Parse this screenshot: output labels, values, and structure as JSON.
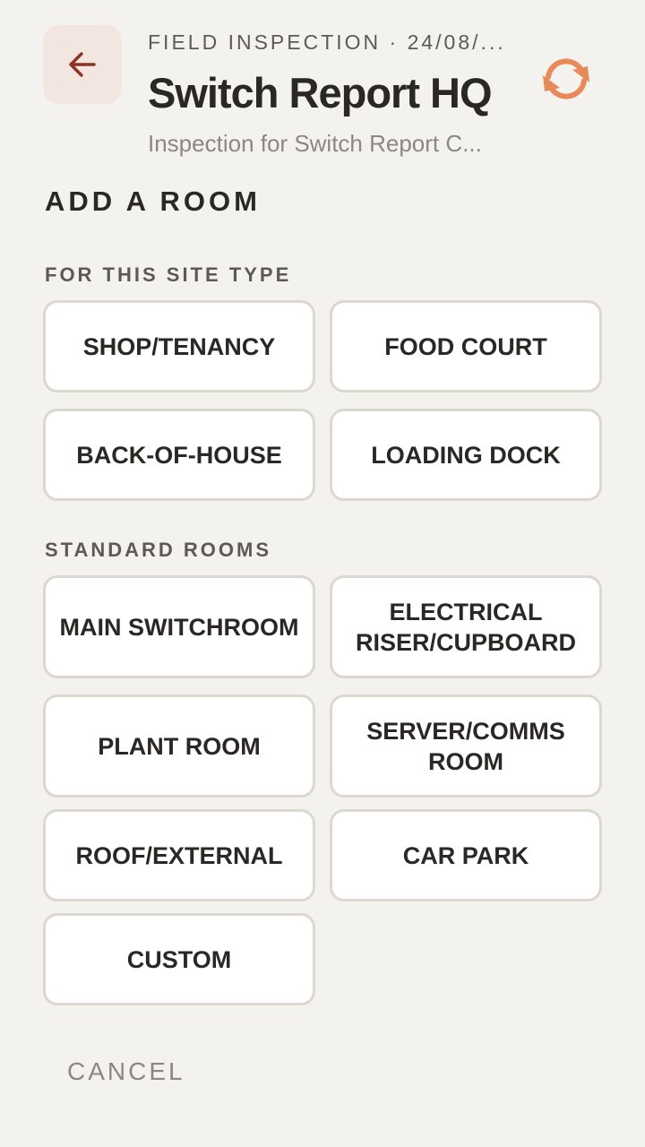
{
  "header": {
    "back_label": "Back",
    "eyebrow": "FIELD INSPECTION · 24/08/...",
    "title": "Switch Report HQ",
    "subtitle": "Inspection for Switch Report C...",
    "sync_label": "Sync"
  },
  "add_room": {
    "heading": "ADD A ROOM",
    "site_type_label": "FOR THIS SITE TYPE",
    "site_type_rooms": [
      "SHOP/TENANCY",
      "FOOD COURT",
      "BACK-OF-HOUSE",
      "LOADING DOCK"
    ],
    "standard_label": "STANDARD ROOMS",
    "standard_rooms": [
      "MAIN SWITCHROOM",
      "ELECTRICAL RISER/CUPBOARD",
      "PLANT ROOM",
      "SERVER/COMMS ROOM",
      "ROOF/EXTERNAL",
      "CAR PARK",
      "CUSTOM"
    ],
    "cancel_label": "CANCEL"
  },
  "colors": {
    "background": "#f4f2ee",
    "back_button_bg": "#f3e6e1",
    "back_arrow": "#8a3422",
    "sync_icon": "#e8895a",
    "button_border": "#ddd7d0",
    "text_primary": "#2b2724",
    "text_muted": "#8e8781"
  },
  "icons": {
    "back": "arrow-left-icon",
    "sync": "sync-icon"
  }
}
